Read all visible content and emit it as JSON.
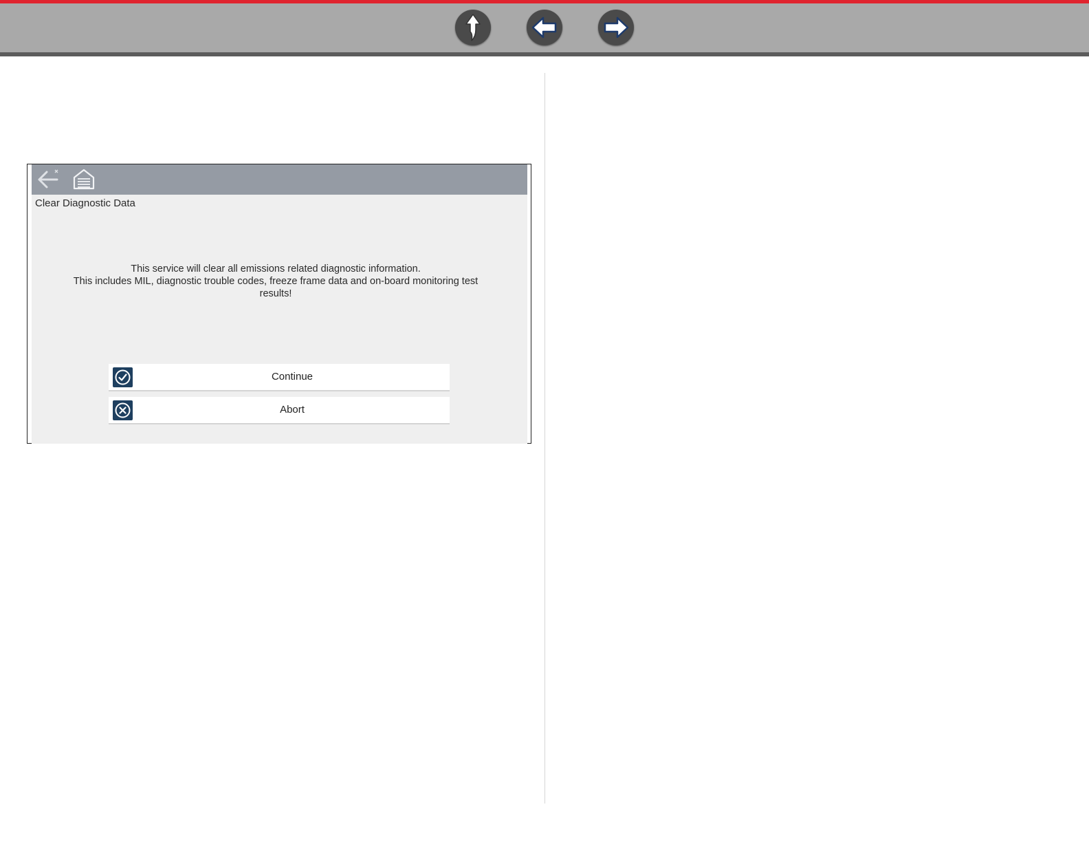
{
  "topbar": {
    "accent_color": "#e0242f",
    "background_color": "#a9a9a9",
    "buttons": [
      {
        "name": "up",
        "icon": "curved-up-arrow-icon"
      },
      {
        "name": "back",
        "icon": "left-arrow-icon"
      },
      {
        "name": "forward",
        "icon": "right-arrow-icon"
      }
    ]
  },
  "device": {
    "toolbar": {
      "back_icon": "back-arrow-icon",
      "home_icon": "home-icon"
    },
    "title": "Clear Diagnostic Data",
    "message": {
      "line1": "This service will clear all emissions related diagnostic information.",
      "line2": "This includes MIL, diagnostic trouble codes, freeze frame data and on-board monitoring test results!"
    },
    "buttons": {
      "continue_label": "Continue",
      "continue_icon": "check-circle-icon",
      "abort_label": "Abort",
      "abort_icon": "x-circle-icon",
      "icon_color": "#1e3f5f"
    }
  }
}
